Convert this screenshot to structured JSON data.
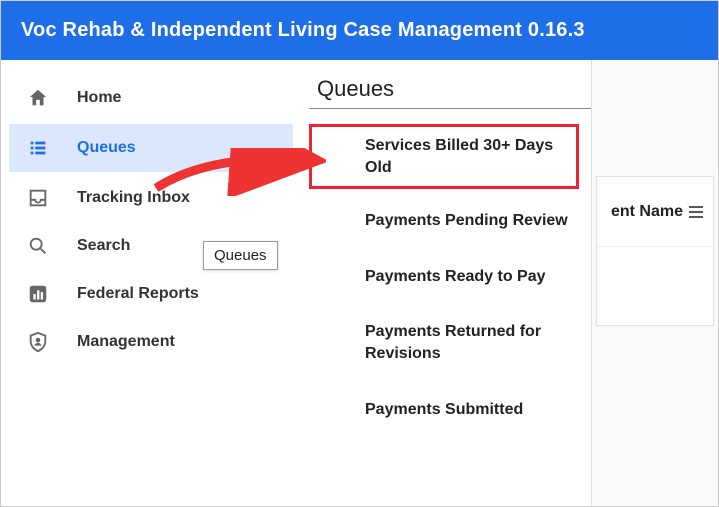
{
  "header": {
    "title": "Voc Rehab & Independent Living Case Management 0.16.3"
  },
  "sidebar": {
    "items": [
      {
        "label": "Home"
      },
      {
        "label": "Queues"
      },
      {
        "label": "Tracking Inbox"
      },
      {
        "label": "Search"
      },
      {
        "label": "Federal Reports"
      },
      {
        "label": "Management"
      }
    ],
    "tooltip": "Queues"
  },
  "submenu": {
    "title": "Queues",
    "items": [
      {
        "label": "Services Billed 30+ Days Old"
      },
      {
        "label": "Payments Pending Review"
      },
      {
        "label": "Payments Ready to Pay"
      },
      {
        "label": "Payments Returned for Revisions"
      },
      {
        "label": "Payments Submitted"
      }
    ]
  },
  "rightpane": {
    "column_partial": "ent Name"
  }
}
